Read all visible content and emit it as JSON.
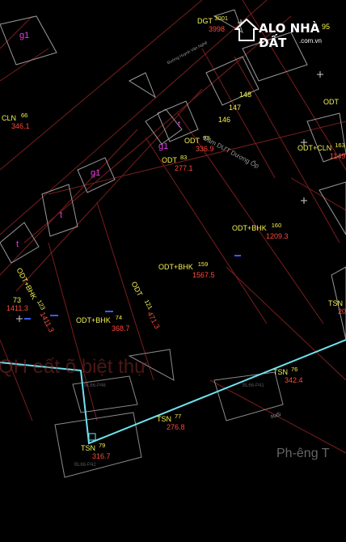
{
  "parcels": [
    {
      "id": "p3001",
      "use": "DGT",
      "num": "3001",
      "area": "3998"
    },
    {
      "id": "p95",
      "use": "",
      "num": "95",
      "area": ""
    },
    {
      "id": "p66",
      "use": "CLN",
      "num": "66",
      "area": "346.1"
    },
    {
      "id": "p148",
      "use": "",
      "num": "148",
      "area": ""
    },
    {
      "id": "p147",
      "use": "",
      "num": "147",
      "area": ""
    },
    {
      "id": "p146",
      "use": "",
      "num": "146",
      "area": ""
    },
    {
      "id": "podt",
      "use": "ODT",
      "num": "",
      "area": ""
    },
    {
      "id": "p93",
      "use": "ODT",
      "num": "93",
      "area": "336.9"
    },
    {
      "id": "p83",
      "use": "ODT",
      "num": "83",
      "area": "277.1"
    },
    {
      "id": "p163",
      "use": "ODT+CLN",
      "num": "163",
      "area": "1149."
    },
    {
      "id": "p160",
      "use": "ODT+BHK",
      "num": "160",
      "area": "1209.3"
    },
    {
      "id": "p159",
      "use": "ODT+BHK",
      "num": "159",
      "area": "1567.5"
    },
    {
      "id": "p73",
      "use": "",
      "num": "73",
      "area": "1411.3"
    },
    {
      "id": "p74",
      "use": "ODT+BHK",
      "num": "74",
      "area": "368.7"
    },
    {
      "id": "p76",
      "use": "TSN",
      "num": "76",
      "area": "342.4"
    },
    {
      "id": "p77",
      "use": "TSN",
      "num": "77",
      "area": "276.8"
    },
    {
      "id": "p79",
      "use": "TSN",
      "num": "79",
      "area": "316.7"
    },
    {
      "id": "ptsn20",
      "use": "TSN",
      "num": "",
      "area": "20"
    }
  ],
  "rotated_labels": {
    "p123": {
      "text": "ODT+BHK",
      "num": "123",
      "area": "1411.3"
    },
    "p121": {
      "text": "ODT",
      "num": "121",
      "area": "471.3"
    }
  },
  "g1_labels": [
    "g1",
    "g1",
    "g1"
  ],
  "t_labels": [
    "t",
    "t",
    "t",
    "t"
  ],
  "road_labels": {
    "road1": "Đường Huỳnh Văn Nghệ",
    "road2": "Đầm DƯT Dương Ốp",
    "stream": "suối"
  },
  "watermark": "QH eất õ biệt thự",
  "zone_label": "Ph-êng T",
  "codes": [
    "BL66-P46",
    "BL66-P41",
    "BL66-P42"
  ],
  "logo": {
    "brand": "ALO NHÀ ĐẤT",
    "domain": ".com.vn"
  }
}
